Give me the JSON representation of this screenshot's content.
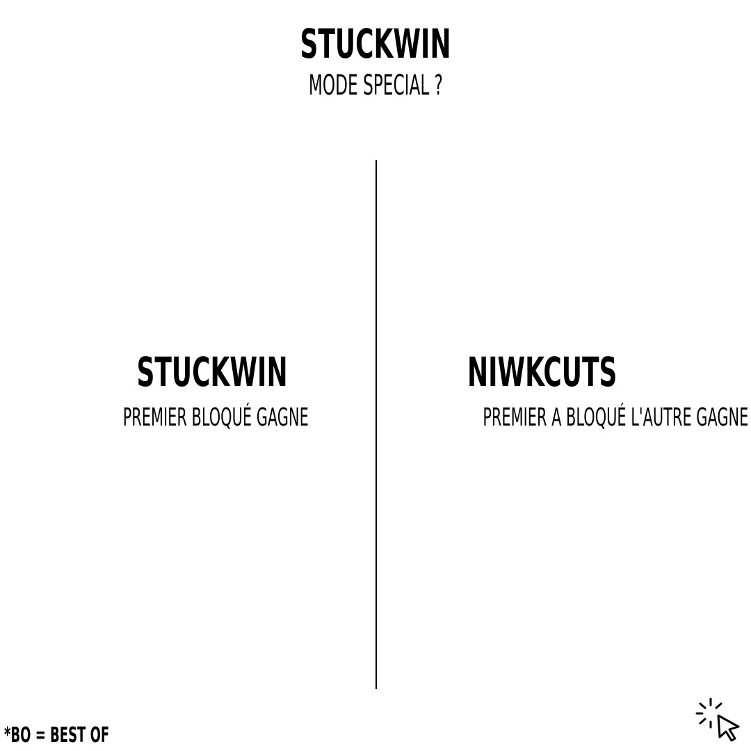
{
  "header": {
    "title": "STUCKWIN",
    "subtitle": "MODE SPECIAL ?"
  },
  "columns": [
    {
      "title": "STUCKWIN",
      "description": "PREMIER BLOQUÉ GAGNE"
    },
    {
      "title": "NIWKCUTS",
      "description": "PREMIER A BLOQUÉ L'AUTRE GAGNE"
    }
  ],
  "footnote": "*BO = BEST OF",
  "icons": {
    "corner": "cursor-click-icon"
  },
  "colors": {
    "background": "#ffffff",
    "text": "#000000",
    "divider": "#000000"
  }
}
